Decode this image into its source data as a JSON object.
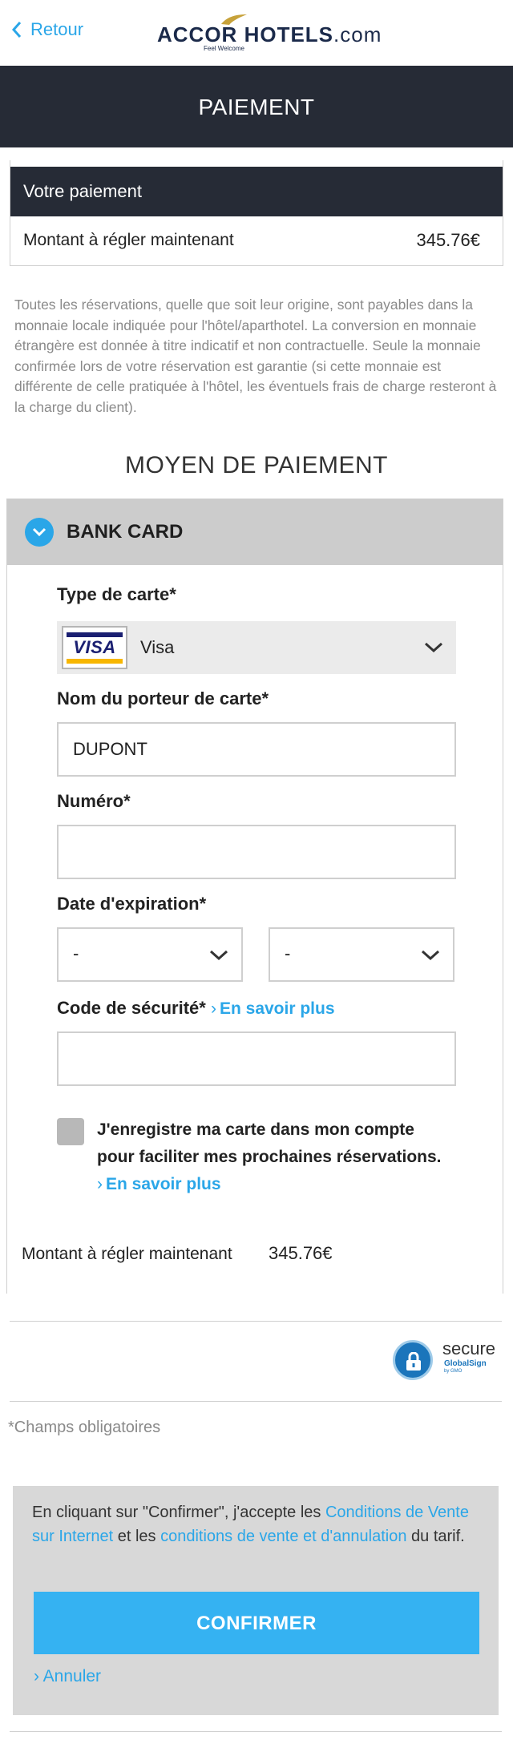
{
  "header": {
    "back_label": "Retour",
    "brand_left": "ACCOR",
    "brand_mid": "HOTELS",
    "brand_right": ".com",
    "brand_tagline": "Feel Welcome",
    "page_title": "PAIEMENT"
  },
  "summary": {
    "heading": "Votre paiement",
    "amount_label": "Montant à régler maintenant",
    "amount_value": "345.76€"
  },
  "notice": "Toutes les réservations, quelle que soit leur origine, sont payables dans la monnaie locale indiquée pour l'hôtel/aparthotel. La conversion en monnaie étrangère est donnée à titre indicatif et non contractuelle. Seule la monnaie confirmée lors de votre réservation est garantie (si cette monnaie est différente de celle pratiquée à l'hôtel, les éventuels frais de charge resteront à la charge du client).",
  "payment_section_title": "MOYEN DE PAIEMENT",
  "card_panel": {
    "title": "BANK CARD",
    "card_type_label": "Type de carte*",
    "card_type_value": "Visa",
    "card_logo_text": "VISA",
    "holder_label": "Nom du porteur de carte*",
    "holder_value": "DUPONT",
    "number_label": "Numéro*",
    "number_value": "",
    "expiry_label": "Date d'expiration*",
    "expiry_month": "-",
    "expiry_year": "-",
    "cvv_label": "Code de sécurité*",
    "cvv_learn_more": "En savoir plus",
    "cvv_value": "",
    "save_card_text": "J'enregistre ma carte dans mon compte pour faciliter mes prochaines réservations.",
    "save_card_learn_more": "En savoir plus",
    "save_card_checked": false,
    "total_label": "Montant à régler maintenant",
    "total_value": "345.76€"
  },
  "secure_badge": {
    "text": "secure",
    "provider": "GlobalSign",
    "subtext": "by GMO"
  },
  "required_note": "*Champs obligatoires",
  "confirm": {
    "text_before": "En cliquant sur \"Confirmer\", j'accepte les ",
    "link1": "Conditions de Vente sur Internet",
    "text_mid": " et les ",
    "link2": "conditions de vente et d'annulation",
    "text_after": " du tarif.",
    "button_label": "CONFIRMER",
    "cancel_label": "Annuler"
  },
  "colors": {
    "accent": "#2aa6e8",
    "dark_header": "#262b36",
    "confirm_button": "#35b2f2",
    "panel_grey": "#cccccc"
  }
}
